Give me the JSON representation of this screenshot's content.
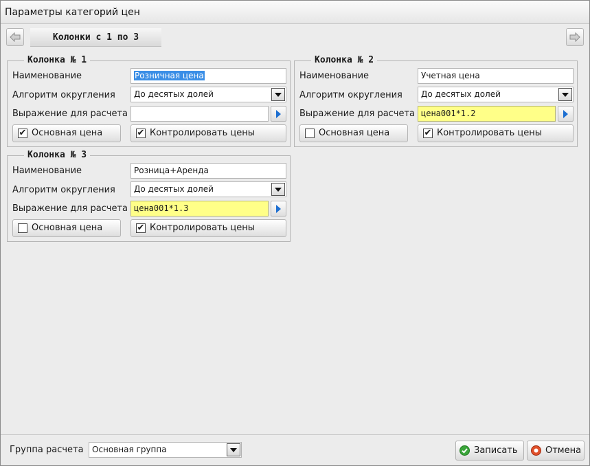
{
  "window": {
    "title": "Параметры категорий цен"
  },
  "pager": {
    "label": "Колонки с 1 по 3"
  },
  "labels": {
    "name": "Наименование",
    "rounding": "Алгоритм округления",
    "expression": "Выражение для расчета",
    "main_price": "Основная цена",
    "control_prices": "Контролировать цены"
  },
  "columns": [
    {
      "title": "Колонка № 1",
      "name": "Розничная цена",
      "rounding": "До десятых долей",
      "expression": "",
      "main_price": true,
      "control_prices": true
    },
    {
      "title": "Колонка № 2",
      "name": "Учетная цена",
      "rounding": "До десятых долей",
      "expression": "цена001*1.2",
      "main_price": false,
      "control_prices": true
    },
    {
      "title": "Колонка № 3",
      "name": "Розница+Аренда",
      "rounding": "До десятых долей",
      "expression": "цена001*1.3",
      "main_price": false,
      "control_prices": true
    }
  ],
  "footer": {
    "group_label": "Группа расчета",
    "group_value": "Основная группа",
    "save_label": "Записать",
    "cancel_label": "Отмена"
  },
  "colors": {
    "expression_fill": "#ffff88",
    "selection": "#3a8ee6",
    "accent_icon": "#1d6fd1"
  }
}
